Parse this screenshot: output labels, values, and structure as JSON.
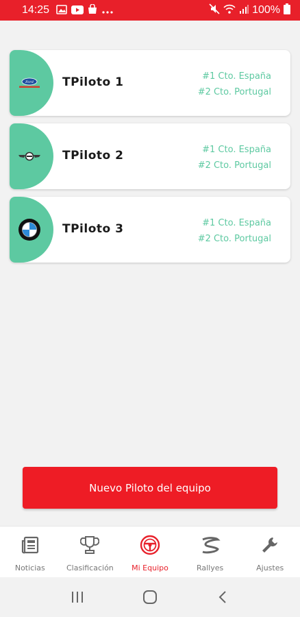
{
  "status_bar": {
    "time": "14:25",
    "battery": "100%"
  },
  "pilots": [
    {
      "name": "TPiloto 1",
      "logo": "ford-logo",
      "championships": [
        "#1 Cto. España",
        "#2 Cto. Portugal"
      ]
    },
    {
      "name": "TPiloto 2",
      "logo": "mini-logo",
      "championships": [
        "#1 Cto. España",
        "#2 Cto. Portugal"
      ]
    },
    {
      "name": "TPiloto 3",
      "logo": "bmw-logo",
      "championships": [
        "#1 Cto. España",
        "#2 Cto. Portugal"
      ]
    }
  ],
  "new_pilot_button": "Nuevo Piloto del equipo",
  "bottom_nav": [
    {
      "label": "Noticias",
      "icon": "newspaper-icon"
    },
    {
      "label": "Clasificación",
      "icon": "trophy-icon"
    },
    {
      "label": "Mi Equipo",
      "icon": "steering-wheel-icon",
      "active": true
    },
    {
      "label": "Rallyes",
      "icon": "road-icon"
    },
    {
      "label": "Ajustes",
      "icon": "wrench-icon"
    }
  ],
  "colors": {
    "primary_red": "#e8202a",
    "accent_green": "#5dc9a1"
  }
}
